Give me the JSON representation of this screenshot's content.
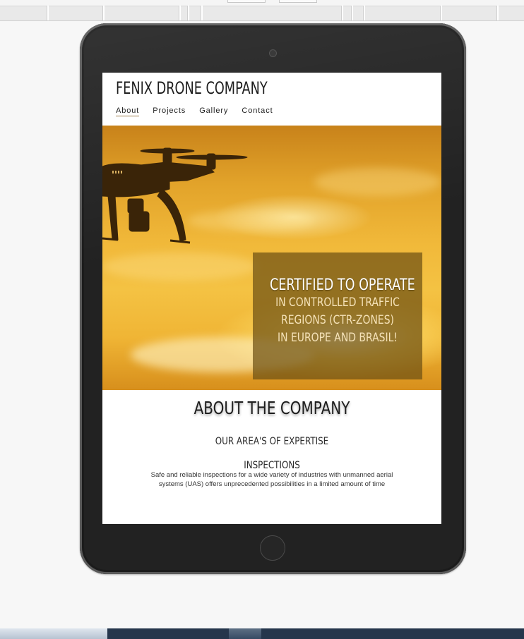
{
  "site": {
    "title": "FENIX DRONE COMPANY",
    "nav": [
      {
        "label": "About",
        "active": true
      },
      {
        "label": "Projects",
        "active": false
      },
      {
        "label": "Gallery",
        "active": false
      },
      {
        "label": "Contact",
        "active": false
      }
    ]
  },
  "hero": {
    "headline": "CERTIFIED TO OPERATE",
    "lines": [
      "IN CONTROLLED TRAFFIC",
      "REGIONS (CTR-ZONES)",
      "IN EUROPE AND BRASIL!"
    ]
  },
  "about": {
    "title": "ABOUT THE COMPANY",
    "subtitle": "OUR AREA'S OF EXPERTISE",
    "section_heading": "INSPECTIONS",
    "section_text": "Safe and reliable inspections for a wide variety of industries with unmanned aerial systems (UAS) offers unprecedented possibilities in a limited amount of time"
  },
  "colors": {
    "accent": "#9a7a4a",
    "overlay": "#6e5014",
    "device": "#222222"
  }
}
